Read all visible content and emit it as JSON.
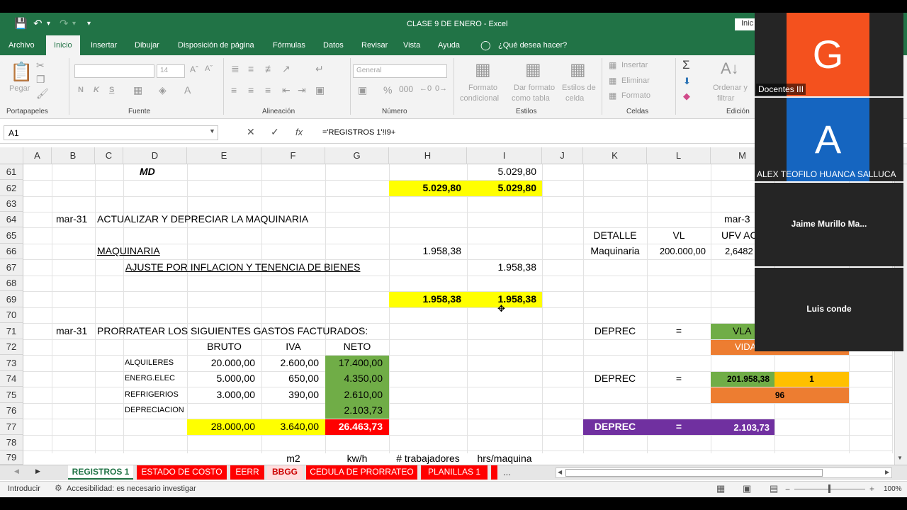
{
  "app": {
    "doc_title": "CLASE 9 DE ENERO  -  Excel",
    "signin": "Inic"
  },
  "ribbon": {
    "tabs": [
      "Archivo",
      "Inicio",
      "Insertar",
      "Dibujar",
      "Disposición de página",
      "Fórmulas",
      "Datos",
      "Revisar",
      "Vista",
      "Ayuda"
    ],
    "tell_me": "¿Qué desea hacer?",
    "groups": [
      "Portapapeles",
      "Fuente",
      "Alineación",
      "Número",
      "Estilos",
      "Celdas",
      "Edición"
    ],
    "paste": "Pegar",
    "font_size": "14",
    "number_format": "General",
    "bold": "N",
    "italic": "K",
    "strike": "S",
    "cond_format": [
      "Formato",
      "condicional"
    ],
    "format_table": [
      "Dar formato",
      "como tabla"
    ],
    "cell_styles": [
      "Estilos de",
      "celda"
    ],
    "insert": "Insertar",
    "delete": "Eliminar",
    "format": "Formato",
    "sort": [
      "Ordenar y",
      "filtrar"
    ]
  },
  "formula_bar": {
    "name_box": "A1",
    "formula": "='REGISTROS 1'!I9+"
  },
  "columns": [
    "A",
    "B",
    "C",
    "D",
    "E",
    "F",
    "G",
    "H",
    "I",
    "J",
    "K",
    "L",
    "M"
  ],
  "rows": [
    "61",
    "62",
    "63",
    "64",
    "65",
    "66",
    "67",
    "68",
    "69",
    "70",
    "71",
    "72",
    "73",
    "74",
    "75",
    "76",
    "77",
    "78",
    "79"
  ],
  "cells": {
    "d61": "MD",
    "i61": "5.029,80",
    "h62": "5.029,80",
    "i62": "5.029,80",
    "b64": "mar-31",
    "c64": "ACTUALIZAR Y DEPRECIAR LA MAQUINARIA",
    "m64": "mar-3",
    "k65": "DETALLE",
    "l65": "VL",
    "m65": "UFV AC",
    "c66": "MAQUINARIA",
    "h66": "1.958,38",
    "k66": "Maquinaria",
    "l66": "200.000,00",
    "m66": "2,6482",
    "d67": "AJUSTE POR INFLACION Y TENENCIA DE BIENES",
    "i67": "1.958,38",
    "h69": "1.958,38",
    "i69": "1.958,38",
    "b71": "mar-31",
    "c71": "PRORRATEAR LOS SIGUIENTES GASTOS FACTURADOS:",
    "k71": "DEPREC",
    "l71": "=",
    "m71": "VLA",
    "e72": "BRUTO",
    "f72": "IVA",
    "g72": "NETO",
    "m72": "VIDA",
    "d73": "ALQUILERES",
    "e73": "20.000,00",
    "f73": "2.600,00",
    "g73": "17.400,00",
    "d74": "ENERG.ELEC",
    "e74": "5.000,00",
    "f74": "650,00",
    "g74": "4.350,00",
    "k74": "DEPREC",
    "l74": "=",
    "m74": "201.958,38",
    "n74": "1",
    "d75": "REFRIGERIOS",
    "e75": "3.000,00",
    "f75": "390,00",
    "g75": "2.610,00",
    "mn75": "96",
    "d76": "DEPRECIACION",
    "g76": "2.103,73",
    "e77": "28.000,00",
    "f77": "3.640,00",
    "g77": "26.463,73",
    "k77": "DEPREC",
    "l77": "=",
    "m77": "2.103,73",
    "f79": "m2",
    "g79": "kw/h",
    "h79": "# trabajadores",
    "i79": "hrs/maquina"
  },
  "sheet_tabs": [
    "REGISTROS 1",
    "ESTADO DE COSTO",
    "EERR",
    "BBGG",
    "CEDULA DE PRORRATEO",
    "PLANILLAS 1",
    "..."
  ],
  "status": {
    "mode": "Introducir",
    "accessibility": "Accesibilidad: es necesario investigar",
    "zoom": "100%"
  },
  "participants": [
    {
      "initial": "G",
      "name": "Docentes III",
      "color": "#f4511e"
    },
    {
      "initial": "A",
      "name": "ALEX TEOFILO HUANCA SALLUCA",
      "color": "#1565c0"
    },
    {
      "initial": "",
      "name": "Jaime  Murillo  Ma..."
    },
    {
      "initial": "",
      "name": "Luis conde"
    }
  ]
}
